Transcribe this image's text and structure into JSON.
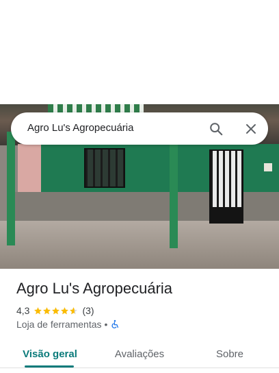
{
  "search": {
    "query": "Agro Lu's Agropecuária"
  },
  "place": {
    "name": "Agro Lu's Agropecuária",
    "rating": "4,3",
    "stars": 4.3,
    "review_count": "(3)",
    "category": "Loja de ferramentas",
    "separator": "•"
  },
  "tabs": [
    {
      "label": "Visão geral",
      "active": true
    },
    {
      "label": "Avaliações",
      "active": false
    },
    {
      "label": "Sobre",
      "active": false
    }
  ],
  "icons": {
    "search": "search-icon",
    "close": "close-icon",
    "accessibility": "wheelchair-icon",
    "star": "star-icon"
  },
  "colors": {
    "accent": "#0b7b7b",
    "star": "#fbbc04",
    "accessibility": "#1a73e8"
  }
}
